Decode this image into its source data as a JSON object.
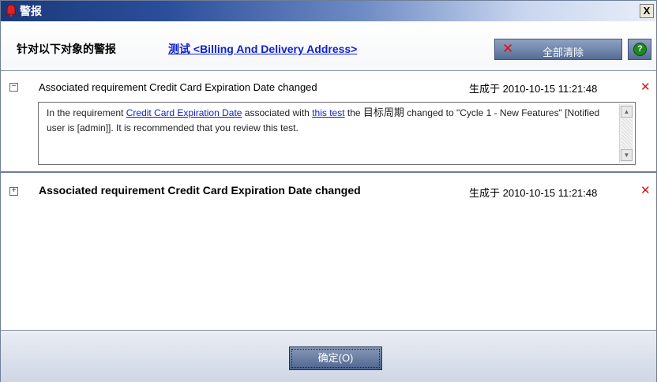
{
  "window": {
    "title": "警报",
    "close_label": "X"
  },
  "header": {
    "label": "针对以下对象的警报",
    "link_text": "测试 <Billing And Delivery Address>",
    "clear_all_label": "全部清除",
    "help_symbol": "?"
  },
  "alerts": [
    {
      "title": "Associated requirement Credit Card Expiration Date changed",
      "generated": "生成于 2010-10-15 11:21:48",
      "expanded": true,
      "toggle": "−",
      "message": {
        "t1": "In the requirement ",
        "link1": "Credit Card Expiration Date",
        "t2": " associated with ",
        "link2": "this test",
        "t3": " the ",
        "field": "目标周期",
        "t4": "  changed to \"Cycle 1 - New Features\" [Notified user is [admin]]. It is recommended that you review this test."
      }
    },
    {
      "title": "Associated requirement Credit Card Expiration Date changed",
      "generated": "生成于 2010-10-15 11:21:48",
      "expanded": false,
      "toggle": "+"
    }
  ],
  "footer": {
    "ok_label": "确定(O)"
  },
  "colors": {
    "link": "#1022cc",
    "delete": "#d21414",
    "help": "#1e8a1e"
  },
  "icons": [
    "alert-bell-icon",
    "close-icon",
    "clear-all-x-icon",
    "help-icon",
    "collapse-icon",
    "expand-icon",
    "delete-x-icon",
    "scroll-up-icon",
    "scroll-down-icon"
  ]
}
